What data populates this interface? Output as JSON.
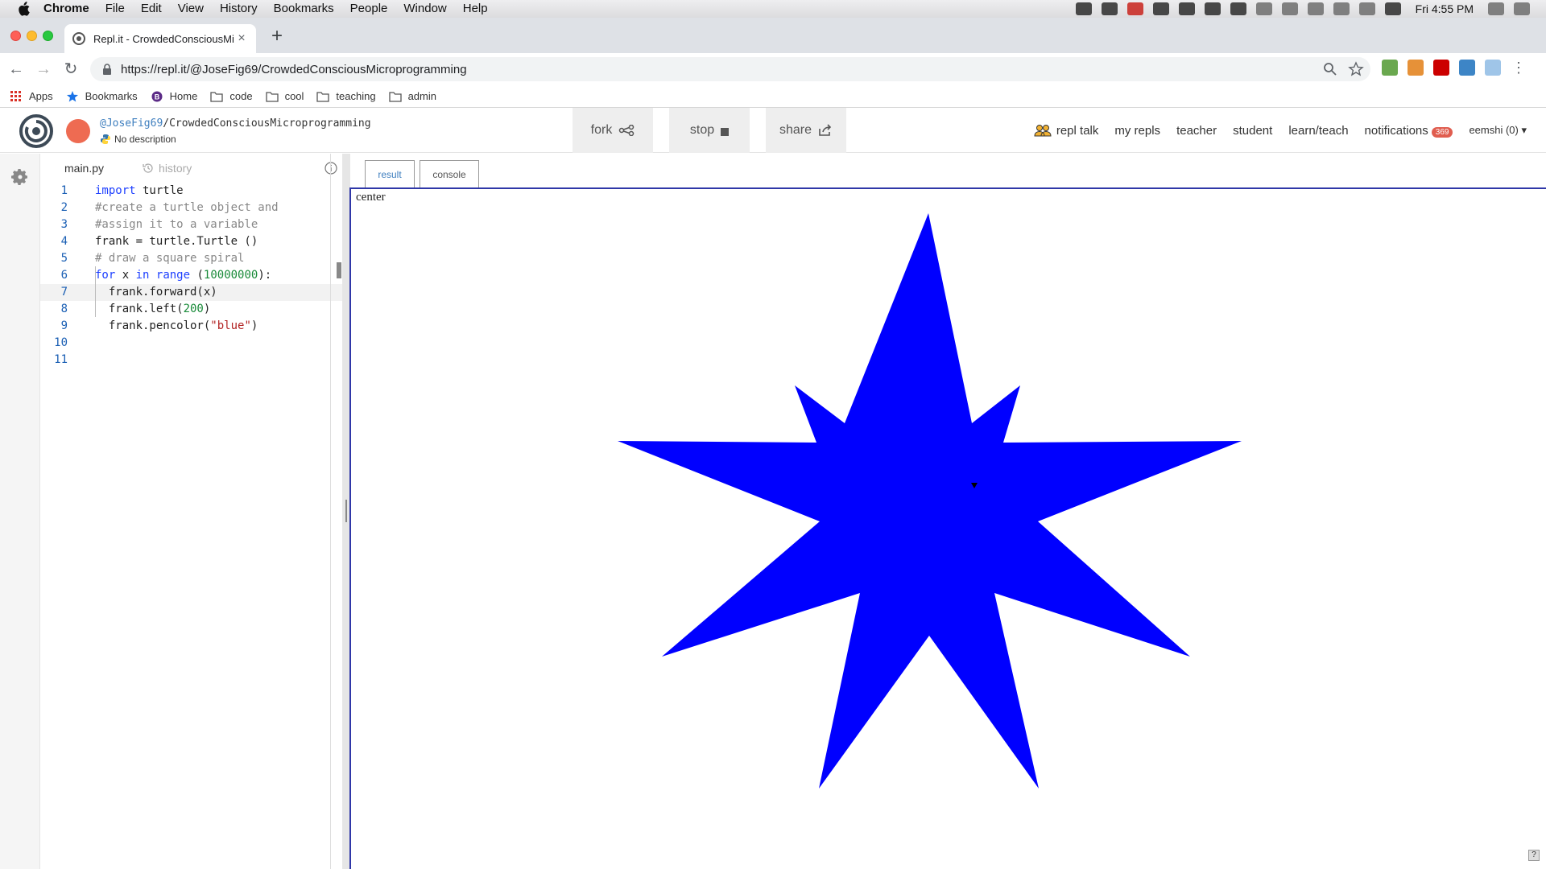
{
  "menubar": {
    "app": "Chrome",
    "menus": [
      "File",
      "Edit",
      "View",
      "History",
      "Bookmarks",
      "People",
      "Window",
      "Help"
    ],
    "clock": "Fri 4:55 PM"
  },
  "browser": {
    "tab_title": "Repl.it - CrowdedConsciousMi",
    "tab_close": "×",
    "new_tab": "+",
    "url": "https://repl.it/@JoseFig69/CrowdedConsciousMicroprogramming"
  },
  "bookmarks": [
    "Apps",
    "Bookmarks",
    "Home",
    "code",
    "cool",
    "teaching",
    "admin"
  ],
  "repl": {
    "user": "@JoseFig69",
    "project": "/CrowdedConsciousMicroprogramming",
    "description": "No description",
    "buttons": {
      "fork": "fork",
      "stop": "stop",
      "share": "share"
    },
    "nav": [
      "repl talk",
      "my repls",
      "teacher",
      "student",
      "learn/teach"
    ],
    "notifications_label": "notifications",
    "notifications_count": "369",
    "account": "eemshi (0) ▾"
  },
  "editor": {
    "tabs": {
      "file": "main.py",
      "history": "history"
    },
    "active_line": 7
  },
  "output": {
    "tabs": {
      "result": "result",
      "console": "console"
    },
    "canvas_label": "center",
    "help": "?"
  },
  "colors": {
    "star_fill": "#0000ff",
    "frame_border": "#2f37a8",
    "badge": "#e05d4f"
  }
}
